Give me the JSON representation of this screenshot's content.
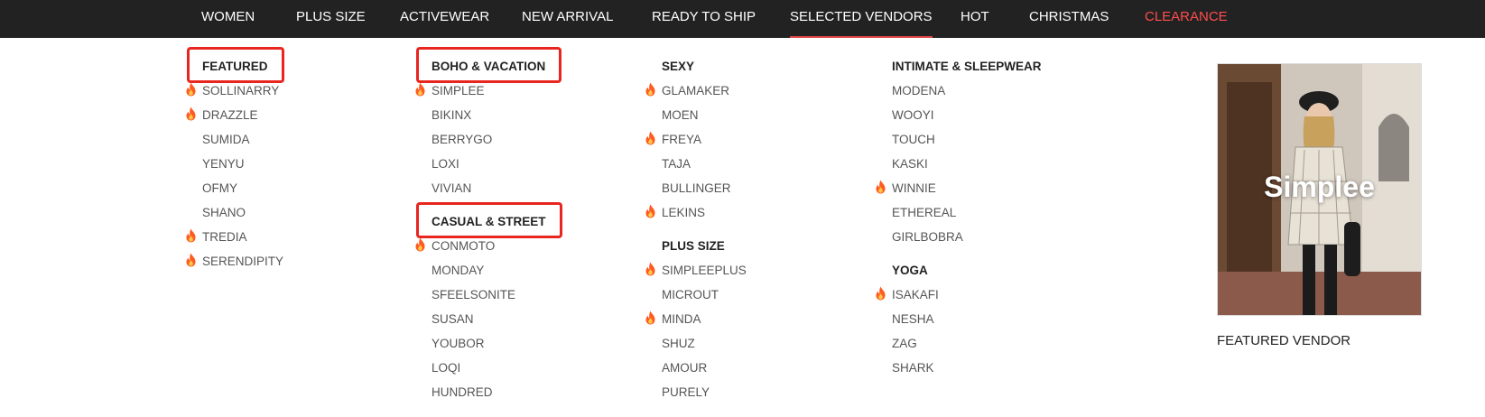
{
  "nav": {
    "items": [
      {
        "label": "WOMEN"
      },
      {
        "label": "PLUS SIZE"
      },
      {
        "label": "ACTIVEWEAR"
      },
      {
        "label": "NEW ARRIVAL"
      },
      {
        "label": "READY TO SHIP"
      },
      {
        "label": "SELECTED VENDORS",
        "active": true
      },
      {
        "label": "HOT"
      },
      {
        "label": "CHRISTMAS"
      },
      {
        "label": "CLEARANCE",
        "color": "#ff4d4d"
      }
    ]
  },
  "menu": {
    "columns": [
      {
        "groups": [
          {
            "title": "FEATURED",
            "highlighted": true,
            "items": [
              {
                "name": "SOLLINARRY",
                "hot": true
              },
              {
                "name": "DRAZZLE",
                "hot": true
              },
              {
                "name": "SUMIDA",
                "hot": false
              },
              {
                "name": "YENYU",
                "hot": false
              },
              {
                "name": "OFMY",
                "hot": false
              },
              {
                "name": "SHANO",
                "hot": false
              },
              {
                "name": "TREDIA",
                "hot": true
              },
              {
                "name": "SERENDIPITY",
                "hot": true
              }
            ]
          }
        ]
      },
      {
        "groups": [
          {
            "title": "BOHO & VACATION",
            "highlighted": true,
            "items": [
              {
                "name": "SIMPLEE",
                "hot": true
              },
              {
                "name": "BIKINX",
                "hot": false
              },
              {
                "name": "BERRYGO",
                "hot": false
              },
              {
                "name": "LOXI",
                "hot": false
              },
              {
                "name": "VIVIAN",
                "hot": false
              }
            ]
          },
          {
            "title": "CASUAL & STREET",
            "highlighted": true,
            "items": [
              {
                "name": "CONMOTO",
                "hot": true
              },
              {
                "name": "MONDAY",
                "hot": false
              },
              {
                "name": "SFEELSONITE",
                "hot": false
              },
              {
                "name": "SUSAN",
                "hot": false
              },
              {
                "name": "YOUBOR",
                "hot": false
              },
              {
                "name": "LOQI",
                "hot": false
              },
              {
                "name": "HUNDRED",
                "hot": false
              }
            ]
          }
        ]
      },
      {
        "groups": [
          {
            "title": "SEXY",
            "highlighted": false,
            "items": [
              {
                "name": "GLAMAKER",
                "hot": true
              },
              {
                "name": "MOEN",
                "hot": false
              },
              {
                "name": "FREYA",
                "hot": true
              },
              {
                "name": "TAJA",
                "hot": false
              },
              {
                "name": "BULLINGER",
                "hot": false
              },
              {
                "name": "LEKINS",
                "hot": true
              }
            ]
          },
          {
            "title": "PLUS SIZE",
            "highlighted": false,
            "items": [
              {
                "name": "SIMPLEEPLUS",
                "hot": true
              },
              {
                "name": "MICROUT",
                "hot": false
              },
              {
                "name": "MINDA",
                "hot": true
              },
              {
                "name": "SHUZ",
                "hot": false
              },
              {
                "name": "AMOUR",
                "hot": false
              },
              {
                "name": "PURELY",
                "hot": false
              }
            ]
          }
        ]
      },
      {
        "groups": [
          {
            "title": "INTIMATE & SLEEPWEAR",
            "highlighted": false,
            "items": [
              {
                "name": "MODENA",
                "hot": false
              },
              {
                "name": "WOOYI",
                "hot": false
              },
              {
                "name": "TOUCH",
                "hot": false
              },
              {
                "name": "KASKI",
                "hot": false
              },
              {
                "name": "WINNIE",
                "hot": true
              },
              {
                "name": "ETHEREAL",
                "hot": false
              },
              {
                "name": "GIRLBOBRA",
                "hot": false
              }
            ]
          },
          {
            "title": "YOGA",
            "highlighted": false,
            "items": [
              {
                "name": "ISAKAFI",
                "hot": true
              },
              {
                "name": "NESHA",
                "hot": false
              },
              {
                "name": "ZAG",
                "hot": false
              },
              {
                "name": "SHARK",
                "hot": false
              }
            ]
          }
        ]
      }
    ]
  },
  "featured": {
    "image_brand": "Simplee",
    "label": "FEATURED VENDOR"
  },
  "colors": {
    "nav_bg": "#222222",
    "highlight_box": "#e8251f",
    "sale": "#ff4d4d",
    "hot_icon": "#ff5a1f"
  }
}
